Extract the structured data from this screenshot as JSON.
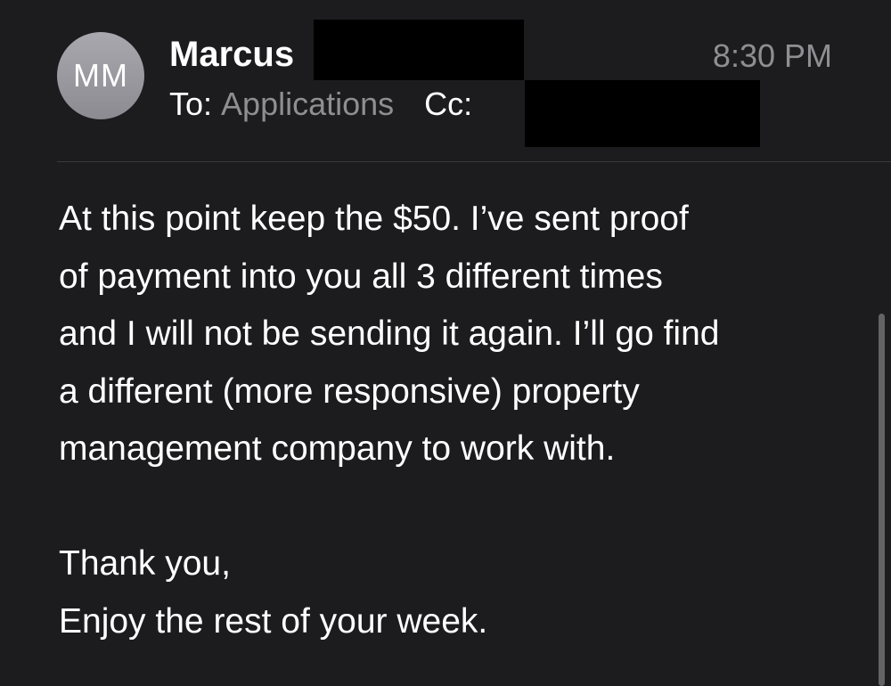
{
  "header": {
    "avatar_initials": "MM",
    "sender_name": "Marcus",
    "time": "8:30 PM",
    "to_label": "To:",
    "to_value": "Applications",
    "cc_label": "Cc:"
  },
  "body": {
    "lines": [
      "At this point keep the $50. I’ve sent proof",
      "of payment into you all 3 different times",
      "and I will not be sending it again. I’ll go find",
      "a different (more responsive) property",
      "management company to work with."
    ],
    "closing": [
      "Thank you,",
      "Enjoy the rest of your week."
    ]
  },
  "colors": {
    "background": "#1c1c1e",
    "secondary_text": "#8e8e93",
    "avatar": "#98989e",
    "divider": "#3a3a3c"
  }
}
